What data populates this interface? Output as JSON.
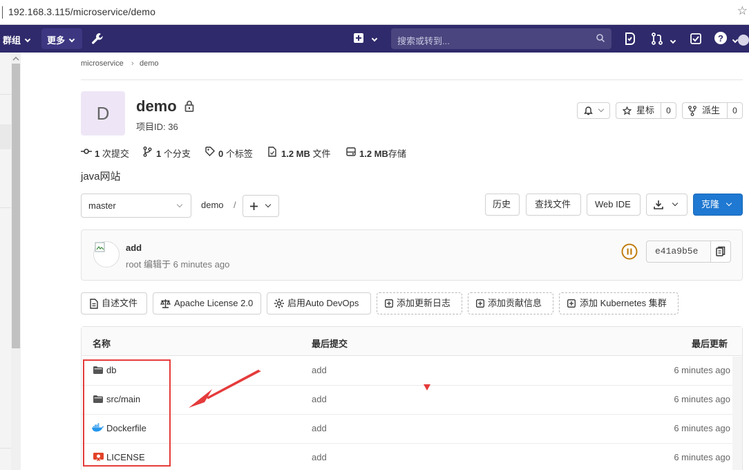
{
  "browser": {
    "url": "192.168.3.115/microservice/demo"
  },
  "nav": {
    "groups_label": "群组",
    "more_label": "更多",
    "search_placeholder": "搜索或转到..."
  },
  "breadcrumb": {
    "parent": "microservice",
    "current": "demo"
  },
  "project": {
    "avatar_letter": "D",
    "name": "demo",
    "id_label": "项目ID: 36",
    "description": "java网站"
  },
  "actions": {
    "star_label": "星标",
    "star_count": "0",
    "fork_label": "派生",
    "fork_count": "0"
  },
  "stats": {
    "commits_num": "1",
    "commits_label": "次提交",
    "branches_num": "1",
    "branches_label": "个分支",
    "tags_num": "0",
    "tags_label": "个标签",
    "files_size": "1.2 MB",
    "files_label": "文件",
    "storage_size": "1.2 MB",
    "storage_label": "存储"
  },
  "repo_toolbar": {
    "branch": "master",
    "path": "demo",
    "path_sep": "/",
    "history": "历史",
    "find_file": "查找文件",
    "web_ide": "Web IDE",
    "clone": "克隆"
  },
  "last_commit": {
    "title": "add",
    "author": "root",
    "meta": "编辑于 6 minutes ago",
    "sha": "e41a9b5e"
  },
  "quick_buttons": [
    {
      "label": "自述文件"
    },
    {
      "label": "Apache License 2.0"
    },
    {
      "label": "启用Auto DevOps"
    },
    {
      "label": "添加更新日志"
    },
    {
      "label": "添加贡献信息"
    },
    {
      "label": "添加 Kubernetes 集群"
    }
  ],
  "table": {
    "headers": {
      "name": "名称",
      "last_commit": "最后提交",
      "last_update": "最后更新"
    },
    "rows": [
      {
        "name": "db",
        "icon": "folder-icon",
        "commit": "add",
        "updated": "6 minutes ago"
      },
      {
        "name": "src/main",
        "icon": "folder-icon",
        "commit": "add",
        "updated": "6 minutes ago"
      },
      {
        "name": "Dockerfile",
        "icon": "docker-icon",
        "commit": "add",
        "updated": "6 minutes ago"
      },
      {
        "name": "LICENSE",
        "icon": "license-icon",
        "commit": "add",
        "updated": "6 minutes ago"
      }
    ]
  },
  "colors": {
    "nav_bg": "#2f2a6b",
    "clone_btn": "#1f78d1",
    "pipeline_status": "#c17d10",
    "annotation": "#e53b3b"
  }
}
